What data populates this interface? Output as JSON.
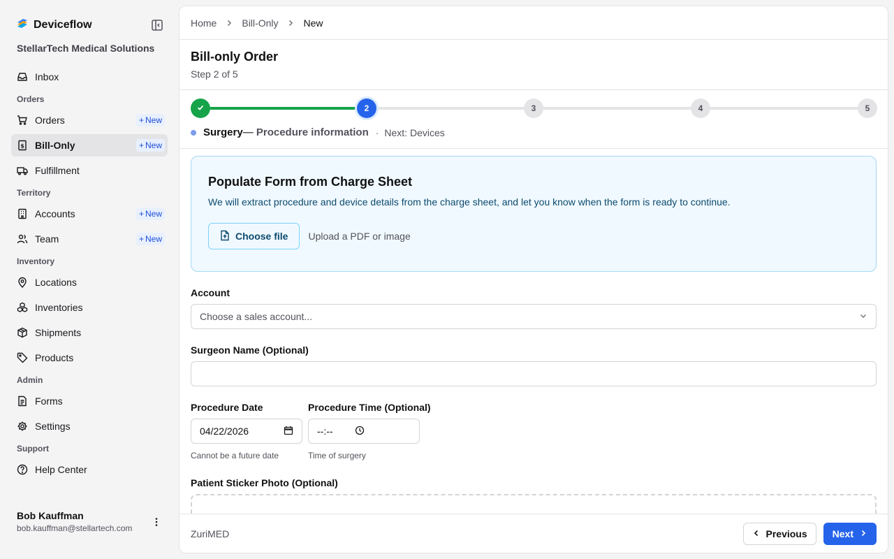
{
  "app": {
    "brand_name": "Deviceflow",
    "org_name": "StellarTech Medical Solutions"
  },
  "sidebar": {
    "inbox": "Inbox",
    "groups": {
      "orders": "Orders",
      "territory": "Territory",
      "inventory": "Inventory",
      "admin": "Admin",
      "support": "Support"
    },
    "items": {
      "orders": "Orders",
      "bill_only": "Bill-Only",
      "fulfillment": "Fulfillment",
      "accounts": "Accounts",
      "team": "Team",
      "locations": "Locations",
      "inventories": "Inventories",
      "shipments": "Shipments",
      "products": "Products",
      "forms": "Forms",
      "settings": "Settings",
      "help_center": "Help Center"
    },
    "new_label": "New"
  },
  "user": {
    "name": "Bob Kauffman",
    "email": "bob.kauffman@stellartech.com"
  },
  "breadcrumb": {
    "home": "Home",
    "section": "Bill-Only",
    "current": "New"
  },
  "page": {
    "title": "Bill-only Order",
    "subtitle": "Step 2 of 5"
  },
  "stepper": {
    "step2": "2",
    "step3": "3",
    "step4": "4",
    "step5": "5",
    "current_name": "Surgery",
    "current_desc": "— Procedure information",
    "separator": "·",
    "next_text": "Next: Devices"
  },
  "charge_sheet": {
    "title": "Populate Form from Charge Sheet",
    "description": "We will extract procedure and device details from the charge sheet, and let you know when the form is ready to continue.",
    "button": "Choose file",
    "hint": "Upload a PDF or image"
  },
  "form": {
    "account_label": "Account",
    "account_placeholder": "Choose a sales account...",
    "surgeon_label": "Surgeon Name (Optional)",
    "date_label": "Procedure Date",
    "date_value": "04/22/2026",
    "date_hint": "Cannot be a future date",
    "time_label": "Procedure Time (Optional)",
    "time_value": "--:--",
    "time_hint": "Time of surgery",
    "sticker_label": "Patient Sticker Photo (Optional)"
  },
  "footer": {
    "brand": "ZuriMED",
    "previous": "Previous",
    "next": "Next"
  },
  "colors": {
    "accent": "#2563eb",
    "success": "#16a34a"
  }
}
